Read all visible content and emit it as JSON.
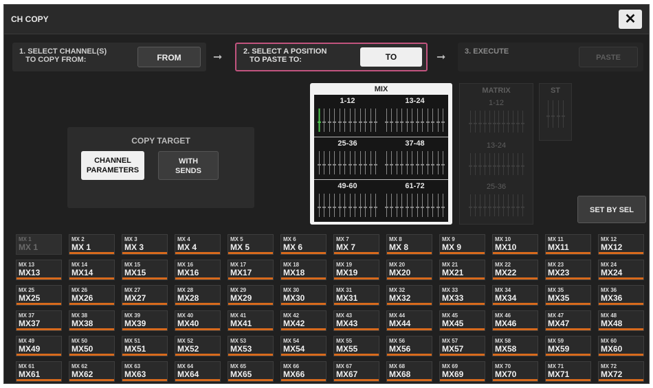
{
  "window": {
    "title": "CH COPY",
    "close_glyph": "✕"
  },
  "steps": {
    "step1": {
      "label": "1. SELECT CHANNEL(S)\n   TO COPY FROM:",
      "button": "FROM"
    },
    "step2": {
      "label": "2. SELECT A POSITION\n   TO PASTE TO:",
      "button": "TO"
    },
    "step3": {
      "label": "3. EXECUTE",
      "button": "PASTE"
    },
    "arrow_glyph": "➞",
    "accent_color": "#c2547f"
  },
  "copy_target": {
    "title": "COPY TARGET",
    "channel_parameters": "CHANNEL\nPARAMETERS",
    "with_sends": "WITH\nSENDS",
    "selected": "channel_parameters"
  },
  "mix": {
    "title": "MIX",
    "segments": [
      "1-12",
      "13-24",
      "25-36",
      "37-48",
      "49-60",
      "61-72"
    ]
  },
  "matrix": {
    "title": "MATRIX",
    "segments": [
      "1-12",
      "13-24",
      "25-36"
    ]
  },
  "st": {
    "title": "ST"
  },
  "set_by_sel": "SET BY SEL",
  "selector_bar_color": "#d86a1c",
  "mix_buttons": [
    {
      "small": "MX 1",
      "big": "MX 1",
      "enabled": false
    },
    {
      "small": "MX 2",
      "big": "MX 1",
      "enabled": true
    },
    {
      "small": "MX 3",
      "big": "MX 3",
      "enabled": true
    },
    {
      "small": "MX 4",
      "big": "MX 4",
      "enabled": true
    },
    {
      "small": "MX 5",
      "big": "MX 5",
      "enabled": true
    },
    {
      "small": "MX 6",
      "big": "MX 6",
      "enabled": true
    },
    {
      "small": "MX 7",
      "big": "MX 7",
      "enabled": true
    },
    {
      "small": "MX 8",
      "big": "MX 8",
      "enabled": true
    },
    {
      "small": "MX 9",
      "big": "MX 9",
      "enabled": true
    },
    {
      "small": "MX 10",
      "big": "MX10",
      "enabled": true
    },
    {
      "small": "MX 11",
      "big": "MX11",
      "enabled": true
    },
    {
      "small": "MX 12",
      "big": "MX12",
      "enabled": true
    },
    {
      "small": "MX 13",
      "big": "MX13",
      "enabled": true
    },
    {
      "small": "MX 14",
      "big": "MX14",
      "enabled": true
    },
    {
      "small": "MX 15",
      "big": "MX15",
      "enabled": true
    },
    {
      "small": "MX 16",
      "big": "MX16",
      "enabled": true
    },
    {
      "small": "MX 17",
      "big": "MX17",
      "enabled": true
    },
    {
      "small": "MX 18",
      "big": "MX18",
      "enabled": true
    },
    {
      "small": "MX 19",
      "big": "MX19",
      "enabled": true
    },
    {
      "small": "MX 20",
      "big": "MX20",
      "enabled": true
    },
    {
      "small": "MX 21",
      "big": "MX21",
      "enabled": true
    },
    {
      "small": "MX 22",
      "big": "MX22",
      "enabled": true
    },
    {
      "small": "MX 23",
      "big": "MX23",
      "enabled": true
    },
    {
      "small": "MX 24",
      "big": "MX24",
      "enabled": true
    },
    {
      "small": "MX 25",
      "big": "MX25",
      "enabled": true
    },
    {
      "small": "MX 26",
      "big": "MX26",
      "enabled": true
    },
    {
      "small": "MX 27",
      "big": "MX27",
      "enabled": true
    },
    {
      "small": "MX 28",
      "big": "MX28",
      "enabled": true
    },
    {
      "small": "MX 29",
      "big": "MX29",
      "enabled": true
    },
    {
      "small": "MX 30",
      "big": "MX30",
      "enabled": true
    },
    {
      "small": "MX 31",
      "big": "MX31",
      "enabled": true
    },
    {
      "small": "MX 32",
      "big": "MX32",
      "enabled": true
    },
    {
      "small": "MX 33",
      "big": "MX33",
      "enabled": true
    },
    {
      "small": "MX 34",
      "big": "MX34",
      "enabled": true
    },
    {
      "small": "MX 35",
      "big": "MX35",
      "enabled": true
    },
    {
      "small": "MX 36",
      "big": "MX36",
      "enabled": true
    },
    {
      "small": "MX 37",
      "big": "MX37",
      "enabled": true
    },
    {
      "small": "MX 38",
      "big": "MX38",
      "enabled": true
    },
    {
      "small": "MX 39",
      "big": "MX39",
      "enabled": true
    },
    {
      "small": "MX 40",
      "big": "MX40",
      "enabled": true
    },
    {
      "small": "MX 41",
      "big": "MX41",
      "enabled": true
    },
    {
      "small": "MX 42",
      "big": "MX42",
      "enabled": true
    },
    {
      "small": "MX 43",
      "big": "MX43",
      "enabled": true
    },
    {
      "small": "MX 44",
      "big": "MX44",
      "enabled": true
    },
    {
      "small": "MX 45",
      "big": "MX45",
      "enabled": true
    },
    {
      "small": "MX 46",
      "big": "MX46",
      "enabled": true
    },
    {
      "small": "MX 47",
      "big": "MX47",
      "enabled": true
    },
    {
      "small": "MX 48",
      "big": "MX48",
      "enabled": true
    },
    {
      "small": "MX 49",
      "big": "MX49",
      "enabled": true
    },
    {
      "small": "MX 50",
      "big": "MX50",
      "enabled": true
    },
    {
      "small": "MX 51",
      "big": "MX51",
      "enabled": true
    },
    {
      "small": "MX 52",
      "big": "MX52",
      "enabled": true
    },
    {
      "small": "MX 53",
      "big": "MX53",
      "enabled": true
    },
    {
      "small": "MX 54",
      "big": "MX54",
      "enabled": true
    },
    {
      "small": "MX 55",
      "big": "MX55",
      "enabled": true
    },
    {
      "small": "MX 56",
      "big": "MX56",
      "enabled": true
    },
    {
      "small": "MX 57",
      "big": "MX57",
      "enabled": true
    },
    {
      "small": "MX 58",
      "big": "MX58",
      "enabled": true
    },
    {
      "small": "MX 59",
      "big": "MX59",
      "enabled": true
    },
    {
      "small": "MX 60",
      "big": "MX60",
      "enabled": true
    },
    {
      "small": "MX 61",
      "big": "MX61",
      "enabled": true
    },
    {
      "small": "MX 62",
      "big": "MX62",
      "enabled": true
    },
    {
      "small": "MX 63",
      "big": "MX63",
      "enabled": true
    },
    {
      "small": "MX 64",
      "big": "MX64",
      "enabled": true
    },
    {
      "small": "MX 65",
      "big": "MX65",
      "enabled": true
    },
    {
      "small": "MX 66",
      "big": "MX66",
      "enabled": true
    },
    {
      "small": "MX 67",
      "big": "MX67",
      "enabled": true
    },
    {
      "small": "MX 68",
      "big": "MX68",
      "enabled": true
    },
    {
      "small": "MX 69",
      "big": "MX69",
      "enabled": true
    },
    {
      "small": "MX 70",
      "big": "MX70",
      "enabled": true
    },
    {
      "small": "MX 71",
      "big": "MX71",
      "enabled": true
    },
    {
      "small": "MX 72",
      "big": "MX72",
      "enabled": true
    }
  ]
}
